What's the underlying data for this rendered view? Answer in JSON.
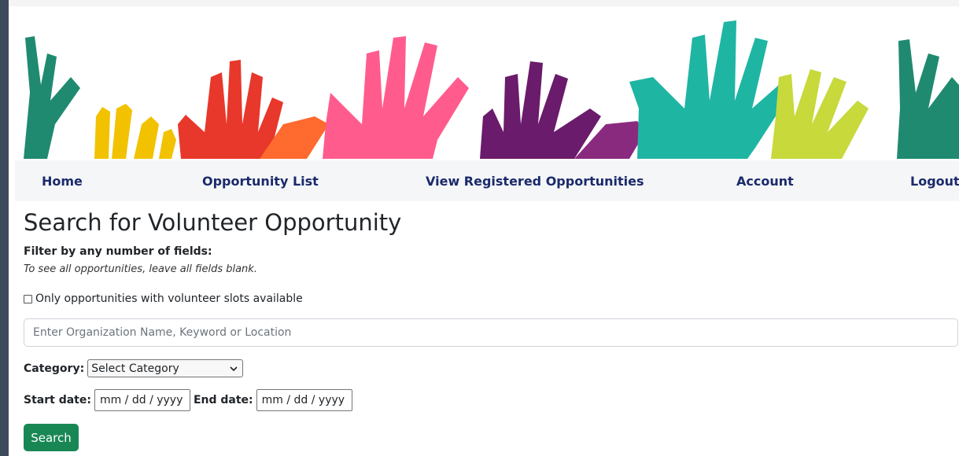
{
  "banner": {
    "image": "raised-colorful-hands",
    "colors": [
      "#1f8a70",
      "#f2c200",
      "#e8372b",
      "#ff5c8d",
      "#6a1b6b",
      "#1fb5a3",
      "#c7d93b"
    ]
  },
  "nav": {
    "home": "Home",
    "opportunity_list": "Opportunity List",
    "view_registered": "View Registered Opportunities",
    "account": "Account",
    "logout": "Logout"
  },
  "page": {
    "title": "Search for Volunteer Opportunity",
    "filter_heading": "Filter by any number of fields:",
    "filter_note": "To see all opportunities, leave all fields blank."
  },
  "filters": {
    "slots_checkbox_label": "Only opportunities with volunteer slots available",
    "slots_checked": false,
    "search_placeholder": "Enter Organization Name, Keyword or Location",
    "search_value": "",
    "category_label": "Category:",
    "category_selected": "Select Category",
    "start_label": "Start date:",
    "start_value": "mm / dd / yyyy",
    "end_label": "End date:",
    "end_value": "mm / dd / yyyy",
    "search_button": "Search"
  },
  "colors": {
    "nav_text": "#1b2a6b",
    "nav_bg": "#f5f6f8",
    "button_bg": "#198754"
  }
}
